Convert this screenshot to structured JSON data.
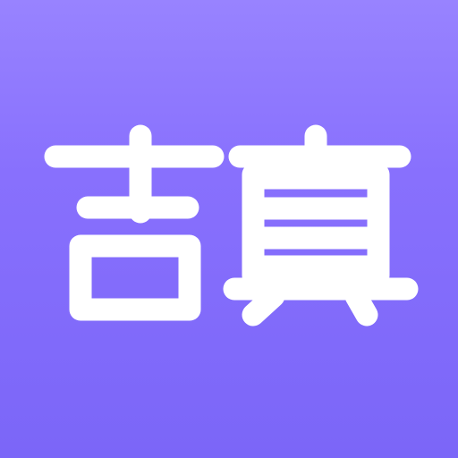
{
  "app_icon": {
    "name_text": "吉真",
    "glyphs": [
      "吉",
      "真"
    ],
    "background_gradient": [
      "#9883ff",
      "#8870fd",
      "#7b66f8"
    ],
    "glyph_color": "#ffffff"
  }
}
